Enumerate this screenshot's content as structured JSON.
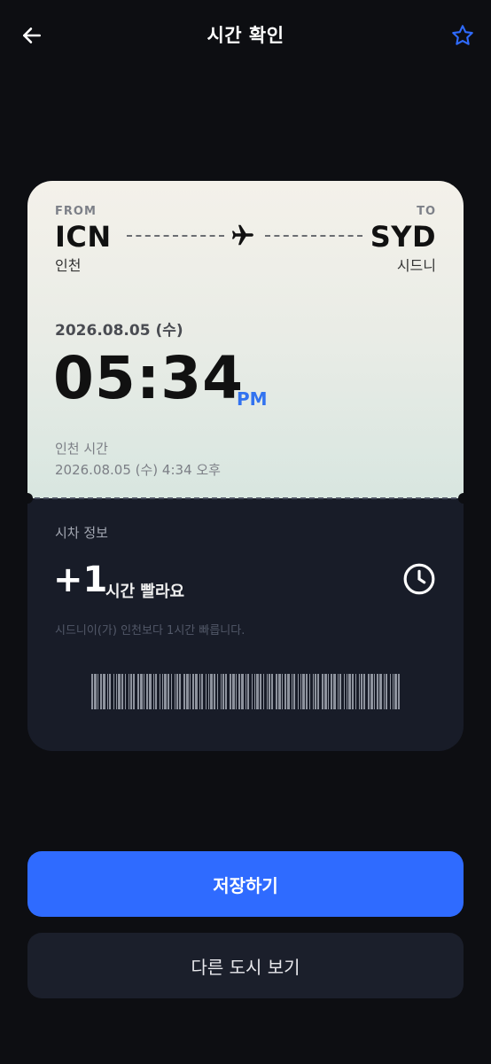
{
  "header": {
    "title": "시간 확인",
    "back_icon": "arrow-left-icon",
    "favorite_icon": "star-outline-icon"
  },
  "route": {
    "from_label": "FROM",
    "from_code": "ICN",
    "from_city": "인천",
    "to_label": "TO",
    "to_code": "SYD",
    "to_city": "시드니",
    "icon": "airplane-icon"
  },
  "destination_time": {
    "date": "2026.08.05 (수)",
    "time": "05:34",
    "ampm": "PM"
  },
  "local_time": {
    "label": "인천 시간",
    "value": "2026.08.05 (수) 4:34 오후"
  },
  "time_difference": {
    "label": "시차 정보",
    "value": "+1",
    "unit": "시간 빨라요",
    "description": "시드니이(가) 인천보다 1시간 빠릅니다.",
    "icon": "clock-icon"
  },
  "actions": {
    "save_label": "저장하기",
    "other_city_label": "다른 도시 보기"
  },
  "colors": {
    "background": "#0d0e12",
    "accent": "#2f6bff",
    "ampm": "#3273f0",
    "ticket_bottom": "#181c28"
  }
}
